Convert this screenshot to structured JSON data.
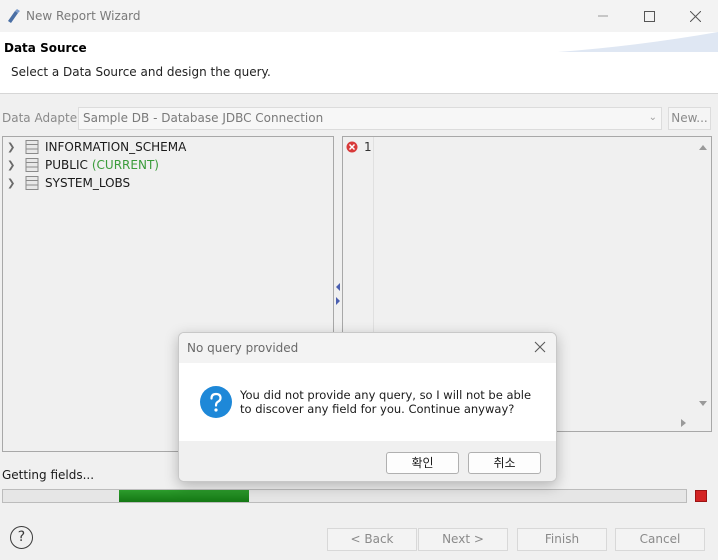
{
  "window": {
    "title": "New Report Wizard"
  },
  "banner": {
    "title": "Data Source",
    "description": "Select a Data Source and design the query."
  },
  "adapter": {
    "label": "Data Adapter",
    "selected": "Sample DB - Database JDBC Connection",
    "new_label": "New..."
  },
  "tree": {
    "items": [
      {
        "label": "INFORMATION_SCHEMA",
        "tag": ""
      },
      {
        "label": "PUBLIC",
        "tag": "(CURRENT)"
      },
      {
        "label": "SYSTEM_LOBS",
        "tag": ""
      }
    ]
  },
  "editor": {
    "line_number": "1"
  },
  "status": {
    "text": "Getting fields...",
    "progress_start": 0.17,
    "progress_end": 0.36
  },
  "nav": {
    "back": "< Back",
    "next": "Next >",
    "finish": "Finish",
    "cancel": "Cancel"
  },
  "dialog": {
    "title": "No query provided",
    "message": "You did not provide any query, so I will not be able to discover any field for you. Continue anyway?",
    "ok": "확인",
    "cancel": "취소"
  },
  "colors": {
    "accent_green": "#1f8a1f",
    "current_tag": "#3a9c3a",
    "info_blue": "#1e88d8",
    "stop_red": "#d42424"
  }
}
